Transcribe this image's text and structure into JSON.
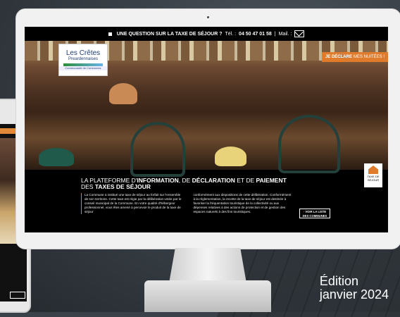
{
  "topbar": {
    "question": "UNE QUESTION SUR LA TAXE DE SÉJOUR ?",
    "tel_label": "Tél. :",
    "phone": "04 50 47 01 58",
    "separator": "|",
    "mail_label": "Mail. :"
  },
  "logo": {
    "line1": "Les Crêtes",
    "line2": "Preardennaises",
    "line3": "Communauté de Communes"
  },
  "declare": {
    "bold": "JE DÉCLARE",
    "rest": "MES NUITÉES !"
  },
  "badge": {
    "line1": "TAXE DE",
    "line2": "SÉJOUR"
  },
  "headline": {
    "part1": "LA PLATEFORME D'",
    "bold1": "INFORMATION",
    "part2": ", DE ",
    "bold2": "DÉCLARATION",
    "part3": " ET DE ",
    "bold3": "PAIEMENT",
    "part4": "DES ",
    "bold4": "TAXES DE SÉJOUR"
  },
  "body": {
    "col1": "La Commune a institué une taxe de séjour au forfait sur l'ensemble de son territoire. Cette taxe est régie par la délibération votée par le conseil municipal de la Commune. En votre qualité d'hébergeur professionnel, vous êtes amené à percevoir le produit de la taxe de séjour",
    "col2": "conformément aux dispositions de cette délibération. Conformément à la réglementation, la recette de la taxe de séjour est destinée à favoriser la fréquentation touristique de la collectivité ou aux dépenses relatives à des actions de protection et de gestion des espaces naturels à des fins touristiques."
  },
  "list_button": {
    "line1": "VOIR LA LISTE",
    "line2": "DES COMMUNES"
  },
  "edition": {
    "line1": "Édition",
    "line2": "janvier 2024"
  },
  "colors": {
    "accent": "#e07b2b",
    "navy": "#1f3f76",
    "background": "#000000"
  },
  "icons": [
    "mail-icon",
    "square-bullet-icon",
    "house-icon",
    "arrow-icon"
  ]
}
